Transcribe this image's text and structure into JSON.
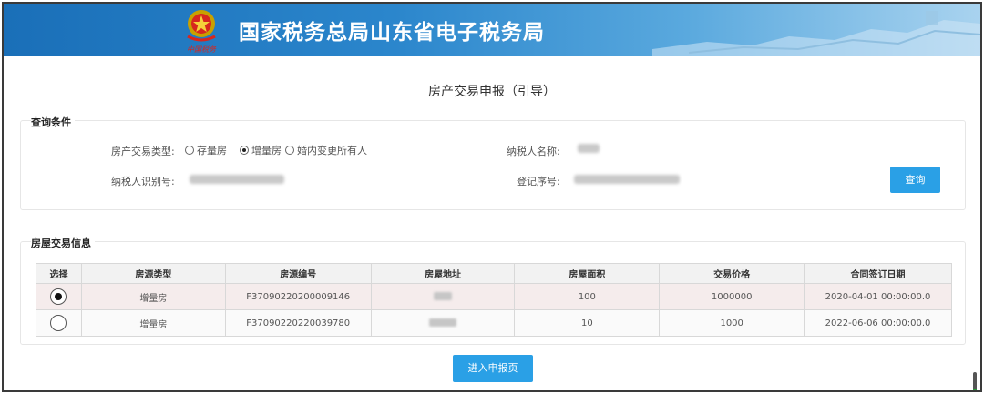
{
  "header": {
    "title": "国家税务总局山东省电子税务局",
    "emblem_text": "中国税务",
    "brand_color": "#2b86cc"
  },
  "page": {
    "title": "房产交易申报（引导）"
  },
  "query": {
    "section_label": "查询条件",
    "transaction_type_label": "房产交易类型:",
    "options": [
      {
        "label": "存量房",
        "selected": false
      },
      {
        "label": "增量房",
        "selected": true
      },
      {
        "label": "婚内变更所有人",
        "selected": false
      }
    ],
    "taxpayer_name_label": "纳税人名称:",
    "taxpayer_id_label": "纳税人识别号:",
    "register_no_label": "登记序号:",
    "search_button": "查询"
  },
  "house": {
    "section_label": "房屋交易信息",
    "columns": [
      "选择",
      "房源类型",
      "房源编号",
      "房屋地址",
      "房屋面积",
      "交易价格",
      "合同签订日期"
    ],
    "rows": [
      {
        "selected": true,
        "type": "增量房",
        "code": "F37090220200009146",
        "area": "100",
        "price": "1000000",
        "date": "2020-04-01 00:00:00.0"
      },
      {
        "selected": false,
        "type": "增量房",
        "code": "F37090220220039780",
        "area": "10",
        "price": "1000",
        "date": "2022-06-06 00:00:00.0"
      }
    ]
  },
  "footer": {
    "submit_button": "进入申报页"
  }
}
